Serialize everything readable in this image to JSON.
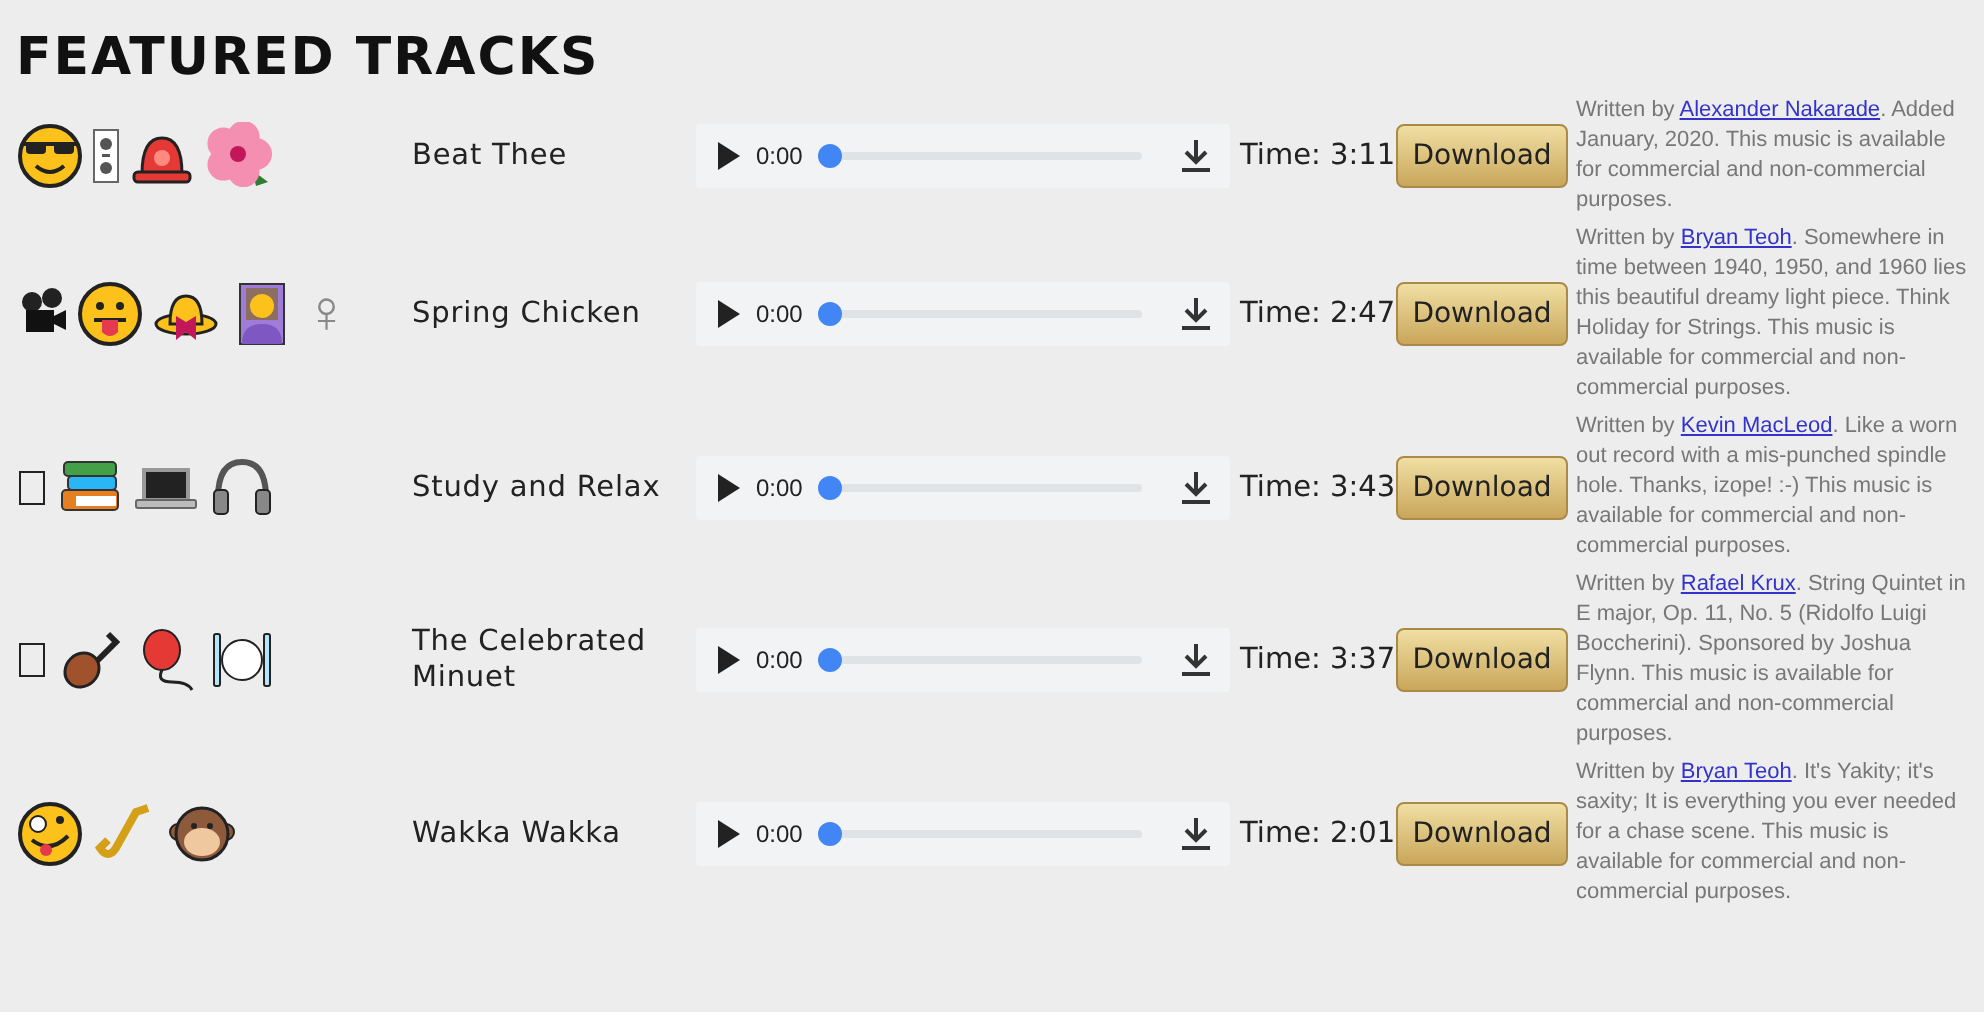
{
  "title": "FEATURED TRACKS",
  "tracks": [
    {
      "name": "Beat Thee",
      "current": "0:00",
      "level": 0,
      "time_label": "Time:",
      "duration": "3:11",
      "button": "Download",
      "prefix": "Written by ",
      "author": "Alexander Nakarade",
      "text": ". Added January, 2020. This music is available for commercial and non-commercial purposes."
    },
    {
      "name": "Spring Chicken",
      "symbol": "♀",
      "current": "0:00",
      "level": 0,
      "time_label": "Time:",
      "duration": "2:47",
      "button": "Download",
      "prefix": "Written by ",
      "author": "Bryan Teoh",
      "text": ". Somewhere in time between 1940, 1950, and 1960 lies this beautiful dreamy light piece. Think Holiday for Strings. This music is available for commercial and non-commercial purposes."
    },
    {
      "name": "Study and Relax",
      "current": "0:00",
      "level": 0,
      "time_label": "Time:",
      "duration": "3:43",
      "button": "Download",
      "prefix": "Written by ",
      "author": "Kevin MacLeod",
      "text": ". Like a worn out record with a mis-punched spindle hole. Thanks, izope! :-) This music is available for commercial and non-commercial purposes."
    },
    {
      "name": "The Celebrated Minuet",
      "current": "0:00",
      "level": 0,
      "time_label": "Time:",
      "duration": "3:37",
      "button": "Download",
      "prefix": "Written by ",
      "author": "Rafael Krux",
      "text": ". String Quintet in E major, Op. 11, No. 5 (Ridolfo Luigi Boccherini). Sponsored by Joshua Flynn. This music is available for commercial and non-commercial purposes."
    },
    {
      "name": "Wakka Wakka",
      "current": "0:00",
      "level": 0,
      "time_label": "Time:",
      "duration": "2:01",
      "button": "Download",
      "prefix": "Written by ",
      "author": "Bryan Teoh",
      "text": ". It's Yakity; it's saxity; It is everything you ever needed for a chase scene. This music is available for commercial and non-commercial purposes."
    }
  ]
}
